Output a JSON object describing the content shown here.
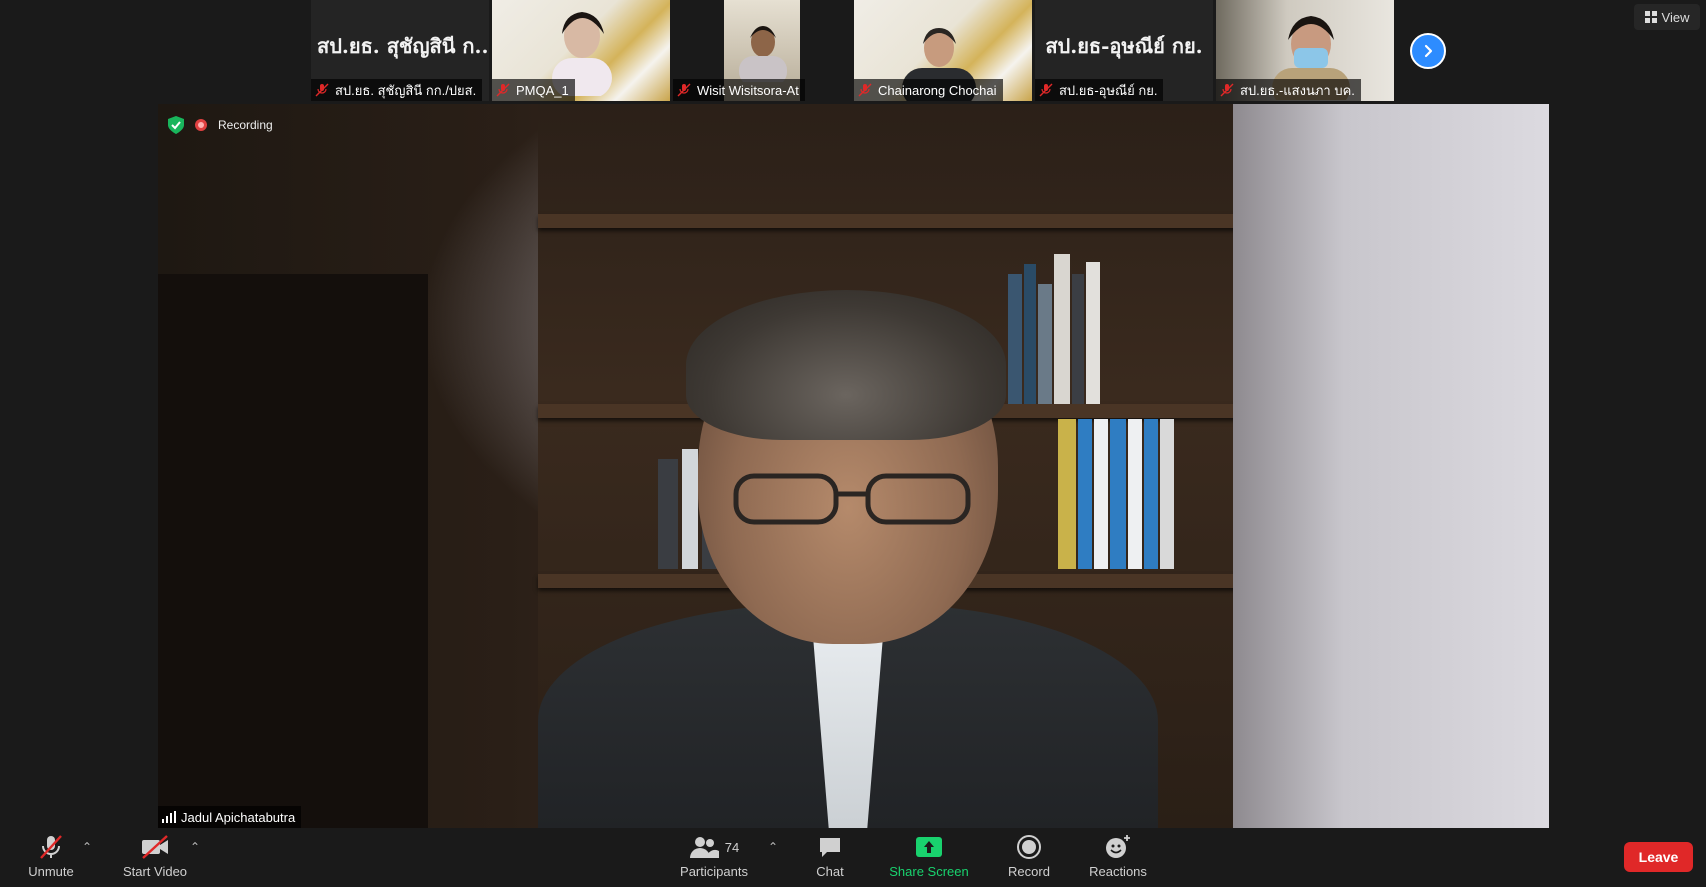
{
  "gallery": {
    "tiles": [
      {
        "display_name": "สป.ยธ. สุชัญสินี ก...",
        "caption": "สป.ยธ. สุชัญสินี กก./ปยส."
      },
      {
        "caption": "PMQA_1"
      },
      {
        "caption": "Wisit Wisitsora-At"
      },
      {
        "caption": "Chainarong Chochai"
      },
      {
        "display_name": "สป.ยธ-อุษณีย์ กย.",
        "caption": "สป.ยธ-อุษณีย์ กย."
      },
      {
        "caption": "สป.ยธ.-แสงนภา บค."
      }
    ],
    "next_icon": "chevron-right-icon",
    "view_label": "View"
  },
  "main_video": {
    "recording_label": "Recording",
    "speaker_name": "Jadul Apichatabutra"
  },
  "toolbar": {
    "unmute_label": "Unmute",
    "start_video_label": "Start Video",
    "participants_label": "Participants",
    "participants_count": "74",
    "chat_label": "Chat",
    "share_screen_label": "Share Screen",
    "record_label": "Record",
    "reactions_label": "Reactions",
    "leave_label": "Leave"
  },
  "colors": {
    "accent_blue": "#2d8cff",
    "share_green": "#19d26e",
    "leave_red": "#e02828",
    "muted_red": "#e02828"
  }
}
